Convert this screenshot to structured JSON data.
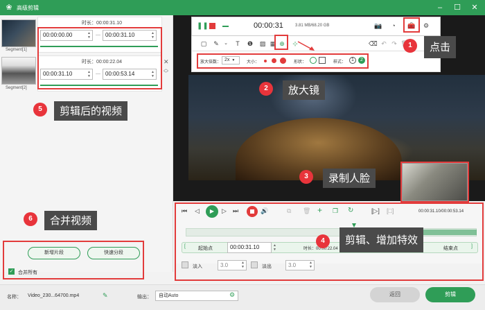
{
  "window": {
    "title": "高级剪辑"
  },
  "segments": [
    {
      "label": "Segment[1]",
      "duration_label": "时长：00:00:31.10",
      "start": "00:00:00.00",
      "end": "00:00:31.10"
    },
    {
      "label": "Segment[2]",
      "duration_label": "时长：00:00:22.04",
      "start": "00:00:31.10",
      "end": "00:00:53.14"
    }
  ],
  "left_actions": {
    "new_segment": "新增片段",
    "quick_split": "快速分段",
    "merge_all": "合并所有"
  },
  "recorder": {
    "time": "00:00:31",
    "storage": "3.81 MB/68.20 GB"
  },
  "zoom_toolbar": {
    "zoom_label": "放大倍数：",
    "zoom_value": "2x",
    "size_label": "大小：",
    "shape_label": "形状：",
    "style_label": "样式：",
    "style_1": "1",
    "style_2": "2"
  },
  "timeline": {
    "time_display": "00:00:31.10/00:00:53.14",
    "start_point": "起始点",
    "start_value": "00:00:31.10",
    "duration_label": "时长：00:00:22.04",
    "end_point": "结束点",
    "fade_in": "淡入",
    "fade_in_value": "3.0",
    "fade_out": "淡出",
    "fade_out_value": "3.0"
  },
  "bottom": {
    "name_label": "名称：",
    "name_value": "Video_230...64700.mp4",
    "output_label": "输出：",
    "output_value": "自动Auto",
    "back": "返回",
    "cut": "剪辑"
  },
  "callouts": [
    {
      "num": "1",
      "text": "点击"
    },
    {
      "num": "2",
      "text": "放大镜"
    },
    {
      "num": "3",
      "text": "录制人脸"
    },
    {
      "num": "4",
      "text": "剪辑、增加特效"
    },
    {
      "num": "5",
      "text": "剪辑后的视频"
    },
    {
      "num": "6",
      "text": "合并视频"
    }
  ],
  "colors": {
    "brand_green": "#2f9d57",
    "callout_red": "#e8343b",
    "highlight_red": "#e23b3b"
  }
}
